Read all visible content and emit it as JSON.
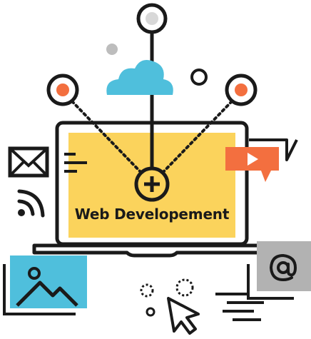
{
  "illustration": {
    "caption": "Web Developement",
    "icons": [
      "laptop-icon",
      "plus-circle-icon",
      "cloud-icon",
      "envelope-icon",
      "wifi-icon",
      "video-play-icon",
      "image-icon",
      "at-sign-icon",
      "cursor-arrow-icon"
    ],
    "colors": {
      "screen": "#fbd35c",
      "cloud": "#4fbfdc",
      "image_bg": "#4fbfdc",
      "video": "#f36f3f",
      "at_bg": "#b2b2b2",
      "accent_dot": "#f36f3f",
      "outline": "#1a1a1a"
    }
  }
}
